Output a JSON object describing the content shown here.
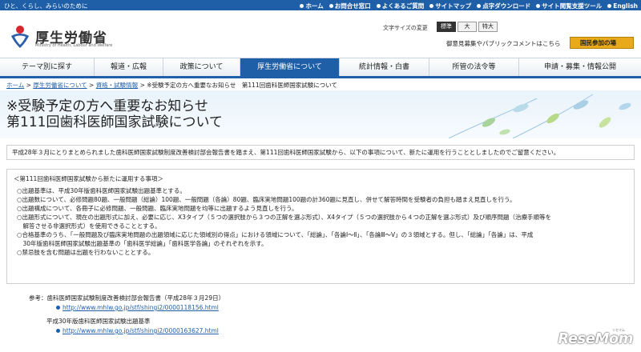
{
  "topbar": {
    "tagline": "ひと、くらし、みらいのために",
    "links": [
      "ホーム",
      "お問合せ窓口",
      "よくあるご質問",
      "サイトマップ",
      "点字ダウンロード",
      "サイト閲覧支援ツール",
      "English"
    ]
  },
  "header": {
    "logo_title": "厚生労働省",
    "logo_sub": "Ministry of Health, Labour and Welfare",
    "text_size_label": "文字サイズの変更",
    "size_options": [
      "標準",
      "大",
      "特大"
    ],
    "opinion_text": "御意見募集やパブリックコメントはこちら",
    "join_button": "国民参加の場"
  },
  "nav": {
    "items": [
      "テーマ別に探す",
      "報道・広報",
      "政策について",
      "厚生労働省について",
      "統計情報・白書",
      "所管の法令等",
      "申請・募集・情報公開"
    ]
  },
  "breadcrumb": {
    "items": [
      "ホーム",
      "厚生労働省について",
      "資格・試験情報"
    ],
    "current": "※受験予定の方へ重要なお知らせ　第111回歯科医師国家試験について"
  },
  "hero": {
    "line1": "※受験予定の方へ重要なお知らせ",
    "line2": "第111回歯科医師国家試験について"
  },
  "lead": "平成28年３月にとりまとめられました歯科医師国家試験制度改善検討部会報告書を踏まえ、第111回歯科医師国家試験から、以下の事項について、新たに運用を行うこととしましたのでご留意ください。",
  "box": {
    "title": "＜第111回歯科医師国家試験から新たに運用する事項＞",
    "items": [
      "○出題基準は、平成30年版歯科医師国家試験出題基準とする。",
      "○出題数について、必修問題80題、一般問題（総論）100題、一般問題（各論）80題、臨床実地問題100題の計360題に見直し、併せて解答時間を受験者の負担も踏まえ見直しを行う。",
      "○出題構成について、各冊子に必修問題、一般問題、臨床実地問題を均等に出題するよう見直しを行う。",
      "○出題形式について、現在の出題形式に加え、必要に応じ、X3タイプ（５つの選択肢から３つの正解を選ぶ形式）、X4タイプ（５つの選択肢から４つの正解を選ぶ形式）及び順序問題（治療手順等を",
      "　解答させる非選択形式）を使用できることとする。",
      "○合格基準のうち、「一般問題及び臨床実地問題の出題領域に応じた領域別の得点」における領域について、「総論」、「各論Ⅰ〜Ⅱ」、「各論Ⅲ〜Ⅴ」の３領域とする。但し、「総論」「各論」は、平成",
      "　30年版歯科医師国家試験出題基準の「歯科医学総論」「歯科医学各論」のそれぞれを示す。",
      "○禁忌肢を含む問題は出題を行わないこととする。"
    ]
  },
  "refs": {
    "label1": "参考：歯科医師国家試験制度改善検討部会報告書（平成28年３月29日）",
    "link1": "http://www.mhlw.go.jp/stf/shingi2/0000118156.html",
    "label2": "平成30年版歯科医師国家試験出題基準",
    "link2": "http://www.mhlw.go.jp/stf/shingi2/0000163627.html"
  },
  "watermark": {
    "text": "ReseMom",
    "small": "リセマム"
  },
  "colors": {
    "brand_blue": "#1f5fa8",
    "join_orange": "#e8a91a",
    "logo_red": "#d7262d",
    "logo_blue": "#2d5fa9"
  }
}
